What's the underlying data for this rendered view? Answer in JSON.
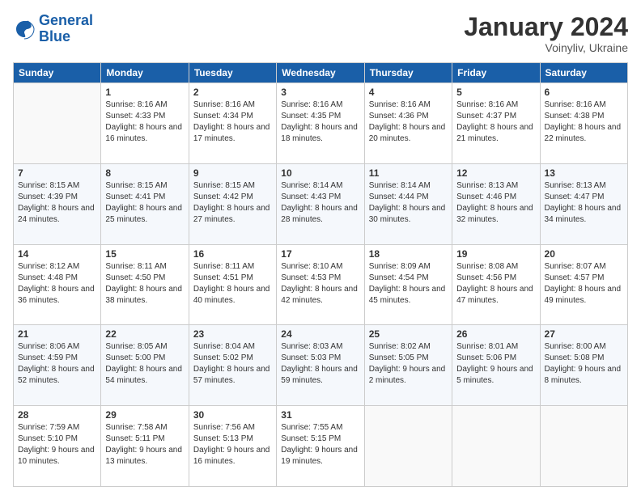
{
  "logo": {
    "line1": "General",
    "line2": "Blue"
  },
  "title": "January 2024",
  "subtitle": "Voinyliv, Ukraine",
  "days_header": [
    "Sunday",
    "Monday",
    "Tuesday",
    "Wednesday",
    "Thursday",
    "Friday",
    "Saturday"
  ],
  "weeks": [
    [
      {
        "day": "",
        "sunrise": "",
        "sunset": "",
        "daylight": ""
      },
      {
        "day": "1",
        "sunrise": "Sunrise: 8:16 AM",
        "sunset": "Sunset: 4:33 PM",
        "daylight": "Daylight: 8 hours and 16 minutes."
      },
      {
        "day": "2",
        "sunrise": "Sunrise: 8:16 AM",
        "sunset": "Sunset: 4:34 PM",
        "daylight": "Daylight: 8 hours and 17 minutes."
      },
      {
        "day": "3",
        "sunrise": "Sunrise: 8:16 AM",
        "sunset": "Sunset: 4:35 PM",
        "daylight": "Daylight: 8 hours and 18 minutes."
      },
      {
        "day": "4",
        "sunrise": "Sunrise: 8:16 AM",
        "sunset": "Sunset: 4:36 PM",
        "daylight": "Daylight: 8 hours and 20 minutes."
      },
      {
        "day": "5",
        "sunrise": "Sunrise: 8:16 AM",
        "sunset": "Sunset: 4:37 PM",
        "daylight": "Daylight: 8 hours and 21 minutes."
      },
      {
        "day": "6",
        "sunrise": "Sunrise: 8:16 AM",
        "sunset": "Sunset: 4:38 PM",
        "daylight": "Daylight: 8 hours and 22 minutes."
      }
    ],
    [
      {
        "day": "7",
        "sunrise": "Sunrise: 8:15 AM",
        "sunset": "Sunset: 4:39 PM",
        "daylight": "Daylight: 8 hours and 24 minutes."
      },
      {
        "day": "8",
        "sunrise": "Sunrise: 8:15 AM",
        "sunset": "Sunset: 4:41 PM",
        "daylight": "Daylight: 8 hours and 25 minutes."
      },
      {
        "day": "9",
        "sunrise": "Sunrise: 8:15 AM",
        "sunset": "Sunset: 4:42 PM",
        "daylight": "Daylight: 8 hours and 27 minutes."
      },
      {
        "day": "10",
        "sunrise": "Sunrise: 8:14 AM",
        "sunset": "Sunset: 4:43 PM",
        "daylight": "Daylight: 8 hours and 28 minutes."
      },
      {
        "day": "11",
        "sunrise": "Sunrise: 8:14 AM",
        "sunset": "Sunset: 4:44 PM",
        "daylight": "Daylight: 8 hours and 30 minutes."
      },
      {
        "day": "12",
        "sunrise": "Sunrise: 8:13 AM",
        "sunset": "Sunset: 4:46 PM",
        "daylight": "Daylight: 8 hours and 32 minutes."
      },
      {
        "day": "13",
        "sunrise": "Sunrise: 8:13 AM",
        "sunset": "Sunset: 4:47 PM",
        "daylight": "Daylight: 8 hours and 34 minutes."
      }
    ],
    [
      {
        "day": "14",
        "sunrise": "Sunrise: 8:12 AM",
        "sunset": "Sunset: 4:48 PM",
        "daylight": "Daylight: 8 hours and 36 minutes."
      },
      {
        "day": "15",
        "sunrise": "Sunrise: 8:11 AM",
        "sunset": "Sunset: 4:50 PM",
        "daylight": "Daylight: 8 hours and 38 minutes."
      },
      {
        "day": "16",
        "sunrise": "Sunrise: 8:11 AM",
        "sunset": "Sunset: 4:51 PM",
        "daylight": "Daylight: 8 hours and 40 minutes."
      },
      {
        "day": "17",
        "sunrise": "Sunrise: 8:10 AM",
        "sunset": "Sunset: 4:53 PM",
        "daylight": "Daylight: 8 hours and 42 minutes."
      },
      {
        "day": "18",
        "sunrise": "Sunrise: 8:09 AM",
        "sunset": "Sunset: 4:54 PM",
        "daylight": "Daylight: 8 hours and 45 minutes."
      },
      {
        "day": "19",
        "sunrise": "Sunrise: 8:08 AM",
        "sunset": "Sunset: 4:56 PM",
        "daylight": "Daylight: 8 hours and 47 minutes."
      },
      {
        "day": "20",
        "sunrise": "Sunrise: 8:07 AM",
        "sunset": "Sunset: 4:57 PM",
        "daylight": "Daylight: 8 hours and 49 minutes."
      }
    ],
    [
      {
        "day": "21",
        "sunrise": "Sunrise: 8:06 AM",
        "sunset": "Sunset: 4:59 PM",
        "daylight": "Daylight: 8 hours and 52 minutes."
      },
      {
        "day": "22",
        "sunrise": "Sunrise: 8:05 AM",
        "sunset": "Sunset: 5:00 PM",
        "daylight": "Daylight: 8 hours and 54 minutes."
      },
      {
        "day": "23",
        "sunrise": "Sunrise: 8:04 AM",
        "sunset": "Sunset: 5:02 PM",
        "daylight": "Daylight: 8 hours and 57 minutes."
      },
      {
        "day": "24",
        "sunrise": "Sunrise: 8:03 AM",
        "sunset": "Sunset: 5:03 PM",
        "daylight": "Daylight: 8 hours and 59 minutes."
      },
      {
        "day": "25",
        "sunrise": "Sunrise: 8:02 AM",
        "sunset": "Sunset: 5:05 PM",
        "daylight": "Daylight: 9 hours and 2 minutes."
      },
      {
        "day": "26",
        "sunrise": "Sunrise: 8:01 AM",
        "sunset": "Sunset: 5:06 PM",
        "daylight": "Daylight: 9 hours and 5 minutes."
      },
      {
        "day": "27",
        "sunrise": "Sunrise: 8:00 AM",
        "sunset": "Sunset: 5:08 PM",
        "daylight": "Daylight: 9 hours and 8 minutes."
      }
    ],
    [
      {
        "day": "28",
        "sunrise": "Sunrise: 7:59 AM",
        "sunset": "Sunset: 5:10 PM",
        "daylight": "Daylight: 9 hours and 10 minutes."
      },
      {
        "day": "29",
        "sunrise": "Sunrise: 7:58 AM",
        "sunset": "Sunset: 5:11 PM",
        "daylight": "Daylight: 9 hours and 13 minutes."
      },
      {
        "day": "30",
        "sunrise": "Sunrise: 7:56 AM",
        "sunset": "Sunset: 5:13 PM",
        "daylight": "Daylight: 9 hours and 16 minutes."
      },
      {
        "day": "31",
        "sunrise": "Sunrise: 7:55 AM",
        "sunset": "Sunset: 5:15 PM",
        "daylight": "Daylight: 9 hours and 19 minutes."
      },
      {
        "day": "",
        "sunrise": "",
        "sunset": "",
        "daylight": ""
      },
      {
        "day": "",
        "sunrise": "",
        "sunset": "",
        "daylight": ""
      },
      {
        "day": "",
        "sunrise": "",
        "sunset": "",
        "daylight": ""
      }
    ]
  ]
}
